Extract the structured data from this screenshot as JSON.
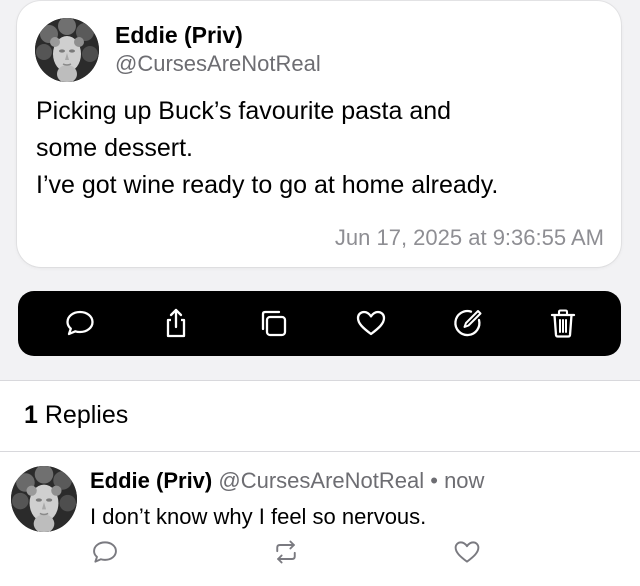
{
  "post": {
    "author_name": "Eddie (Priv)",
    "author_handle": "@CursesAreNotReal",
    "text_lines": [
      "Picking up Buck’s favourite pasta and",
      "some dessert.",
      "I’ve got wine ready to go at home already."
    ],
    "timestamp": "Jun 17, 2025 at 9:36:55 AM",
    "avatar_icon": "statue-head-avatar"
  },
  "action_bar": {
    "icons": [
      "comment-icon",
      "share-icon",
      "copy-icon",
      "heart-icon",
      "edit-icon",
      "trash-icon"
    ],
    "background": "#000000",
    "icon_color": "#ffffff"
  },
  "replies": {
    "count": "1",
    "label": "Replies",
    "items": [
      {
        "author_name": "Eddie (Priv)",
        "author_handle": "@CursesAreNotReal",
        "separator": "•",
        "time": "now",
        "text": "I don’t know why I feel so nervous.",
        "actions": [
          "comment-icon",
          "repost-icon",
          "heart-icon"
        ]
      }
    ]
  },
  "colors": {
    "background": "#f2f2f4",
    "card": "#ffffff",
    "secondary_text": "#6d6d72",
    "timestamp_text": "#8e8e93"
  }
}
